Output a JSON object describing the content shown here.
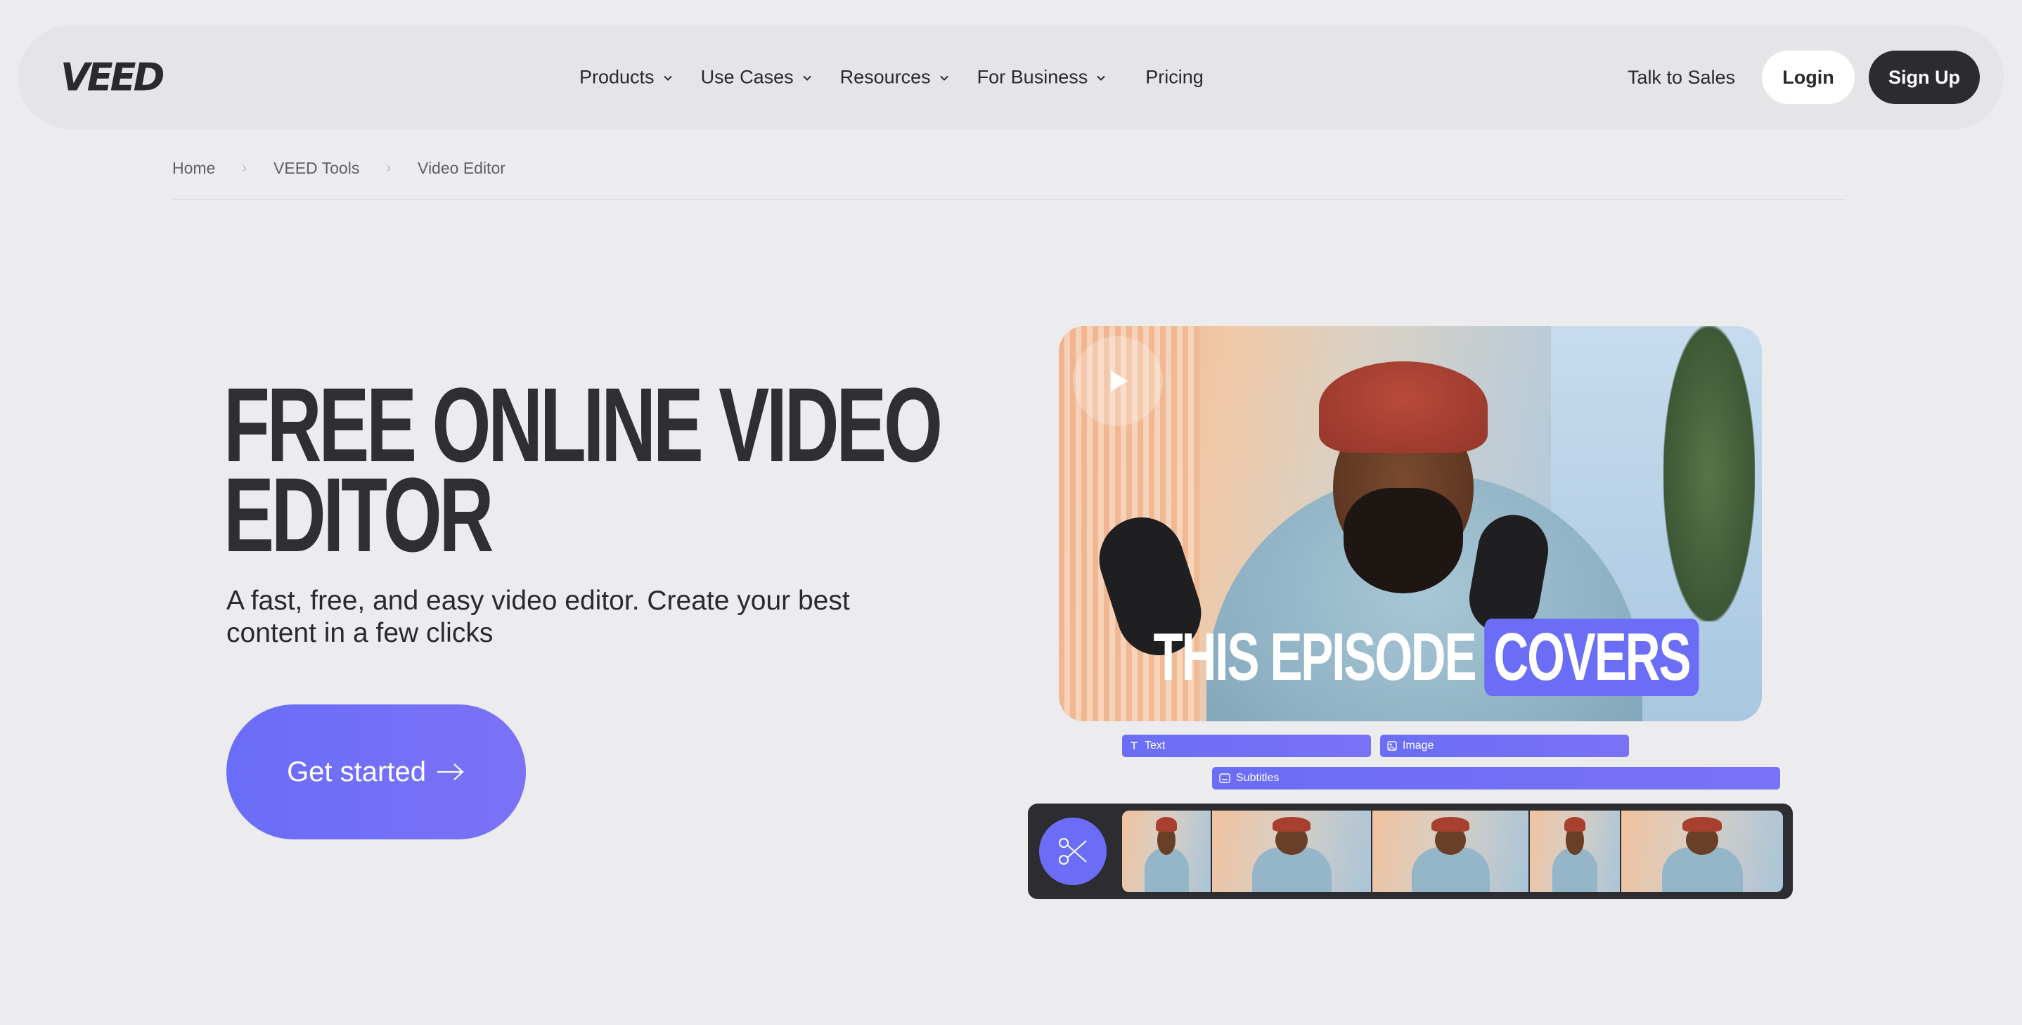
{
  "nav": {
    "logo": "VEED",
    "menu": [
      {
        "label": "Products",
        "dropdown": true
      },
      {
        "label": "Use Cases",
        "dropdown": true
      },
      {
        "label": "Resources",
        "dropdown": true
      },
      {
        "label": "For Business",
        "dropdown": true
      },
      {
        "label": "Pricing",
        "dropdown": false
      }
    ],
    "talk_to_sales": "Talk to Sales",
    "login": "Login",
    "signup": "Sign Up"
  },
  "breadcrumb": [
    "Home",
    "VEED Tools",
    "Video Editor"
  ],
  "hero": {
    "title_line1": "FREE ONLINE VIDEO",
    "title_line2": "EDITOR",
    "subtitle_line1": "A fast, free, and easy video editor. Create your best",
    "subtitle_line2": "content in a few clicks",
    "cta": "Get started"
  },
  "video": {
    "caption_text": "THIS EPISODE",
    "caption_highlight": "COVERS"
  },
  "tracks": {
    "text": "Text",
    "image": "Image",
    "subtitles": "Subtitles"
  },
  "colors": {
    "accent": "#6b6df6",
    "background": "#ececef",
    "dark": "#2c2c30"
  }
}
